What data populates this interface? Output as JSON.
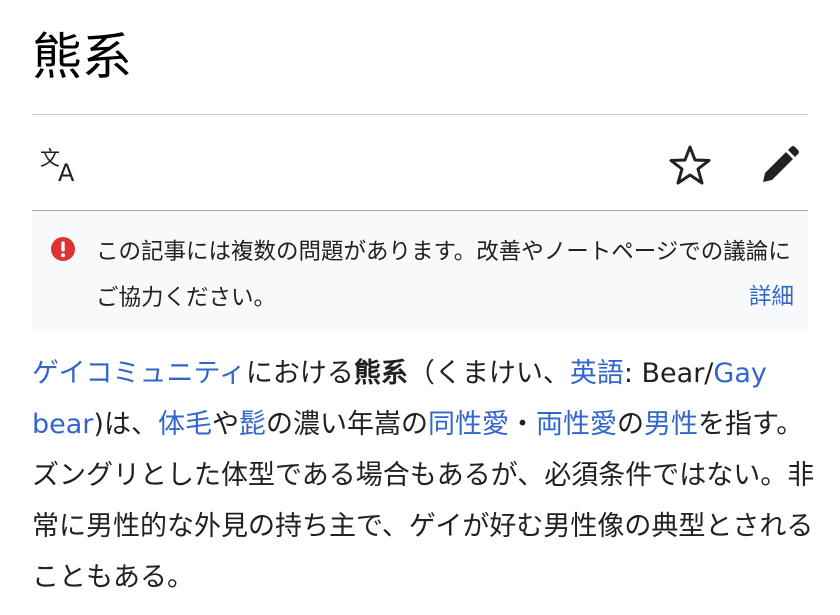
{
  "page": {
    "title": "熊系"
  },
  "toolbar": {
    "language_icon": "translate-icon",
    "watch_icon": "star-icon",
    "edit_icon": "pencil-icon"
  },
  "notice": {
    "icon": "exclamation-circle-icon",
    "text": "この記事には複数の問題があります。改善やノートページでの議論にご協力ください。",
    "details_link": "詳細",
    "icon_color": "#dd3333"
  },
  "article": {
    "link_gay_community": "ゲイコミュニティ",
    "text_1": "における",
    "bold_term": "熊系",
    "text_2": "（くまけい、",
    "link_english": "英語",
    "text_3": ": Bear/",
    "link_gay_bear": "Gay bear",
    "text_4": ")は、",
    "link_body_hair": "体毛",
    "text_5": "や",
    "link_beard": "髭",
    "text_6": "の濃い年嵩の",
    "link_homosexual": "同性愛",
    "text_7": "・",
    "link_bisexual": "両性愛",
    "text_8": "の",
    "link_male": "男性",
    "text_9": "を指す。ズングリとした体型である場合もあるが、必須条件ではない。非常に男性的な外見の持ち主で、ゲイが好む男性像の典型とされることもある。"
  },
  "colors": {
    "link": "#3366cc",
    "text": "#202122",
    "notice_bg": "#f8f9fa"
  }
}
